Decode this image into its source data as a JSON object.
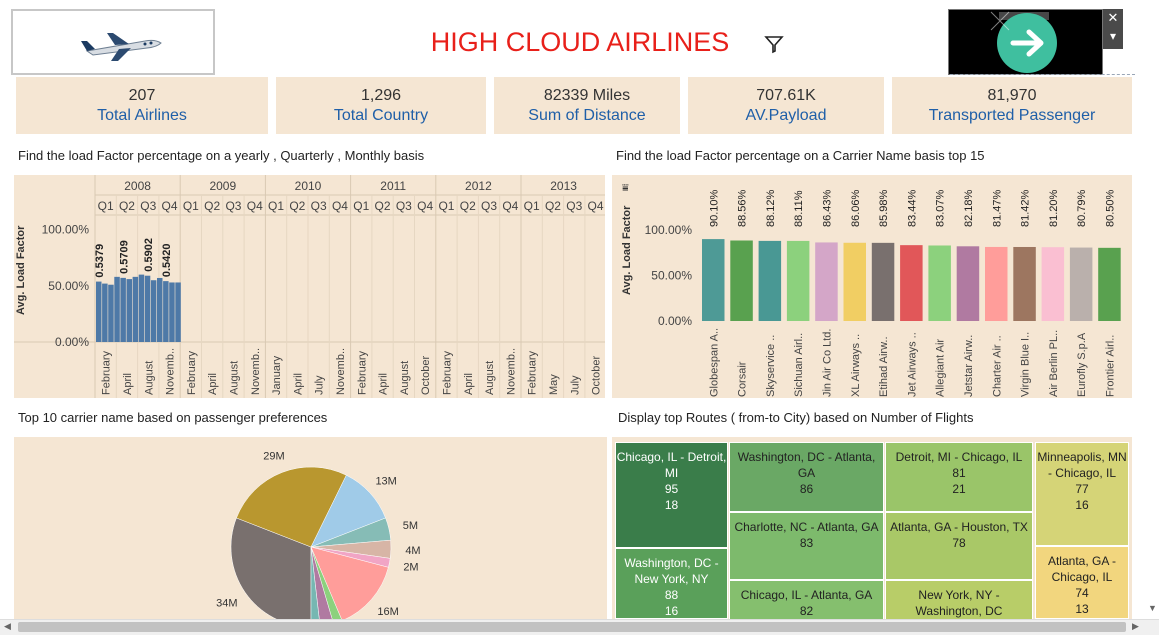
{
  "header": {
    "title": "HIGH CLOUD AIRLINES",
    "logo_icon": "airplane-logo-icon",
    "filter_icon": "filter-icon",
    "ad_icon": "arrow-right-icon",
    "close_symbol": "✕",
    "menu_symbol": "▾"
  },
  "kpis": [
    {
      "value": "207",
      "label": "Total Airlines"
    },
    {
      "value": "1,296",
      "label": "Total Country"
    },
    {
      "value": "82339 Miles",
      "label": "Sum of Distance"
    },
    {
      "value": "707.61K",
      "label": "AV.Payload"
    },
    {
      "value": "81,970",
      "label": "Transported Passenger"
    }
  ],
  "sections": {
    "load_yearly_title": "Find the load Factor percentage on a yearly , Quarterly , Monthly basis",
    "load_carrier_title": "Find the load Factor percentage on a Carrier Name basis top 15",
    "passenger_title": "Top 10 carrier name based on passenger preferences",
    "routes_title": "Display top Routes ( from-to City) based on Number of Flights"
  },
  "chart_data": [
    {
      "type": "bar",
      "title": "Find the load Factor percentage on a yearly , Quarterly , Monthly basis",
      "ylabel": "Avg. Load Factor",
      "ylim": [
        0,
        1
      ],
      "yticks": [
        "100.00%",
        "50.00%",
        "0.00%"
      ],
      "years": [
        "2008",
        "2009",
        "2010",
        "2011",
        "2012",
        "2013"
      ],
      "quarters": [
        "Q1",
        "Q2",
        "Q3",
        "Q4"
      ],
      "month_labels": [
        "February",
        "April",
        "August",
        "Novemb..",
        "February",
        "April",
        "August",
        "Novemb..",
        "January",
        "April",
        "July",
        "Novemb..",
        "February",
        "April",
        "August",
        "October",
        "February",
        "April",
        "August",
        "Novemb..",
        "February",
        "May",
        "July",
        "October"
      ],
      "values": [
        0.5379,
        0.52,
        0.51,
        0.58,
        0.5709,
        0.56,
        0.58,
        0.6,
        0.5902,
        0.55,
        0.57,
        0.542,
        0.53,
        0.53
      ],
      "data_labels": [
        "0.5379",
        "0.5709",
        "0.5902",
        "0.5420"
      ],
      "grid": true
    },
    {
      "type": "bar",
      "title": "Find the load Factor percentage on a Carrier Name basis top 15",
      "ylabel": "Avg. Load Factor",
      "ylim": [
        0,
        1
      ],
      "yticks": [
        "100.00%",
        "50.00%",
        "0.00%"
      ],
      "categories": [
        "Globespan A..",
        "Corsair",
        "Skyservice ..",
        "Sichuan Airl..",
        "Jin Air Co Ltd.",
        "XL Airways ..",
        "Etihad Airw..",
        "Jet Airways ..",
        "Allegiant Air",
        "Jetstar Airw..",
        "Charter Air ..",
        "Virgin Blue I..",
        "Air Berlin PL..",
        "Eurofly S.p.A",
        "Frontier Airl.."
      ],
      "values": [
        0.901,
        0.8856,
        0.8812,
        0.8811,
        0.8643,
        0.8606,
        0.8598,
        0.8344,
        0.8307,
        0.8218,
        0.8147,
        0.8142,
        0.812,
        0.8079,
        0.805
      ],
      "labels": [
        "90.10%",
        "88.56%",
        "88.12%",
        "88.11%",
        "86.43%",
        "86.06%",
        "85.98%",
        "83.44%",
        "83.07%",
        "82.18%",
        "81.47%",
        "81.42%",
        "81.20%",
        "80.79%",
        "80.50%"
      ],
      "colors": [
        "#4e9a96",
        "#59a14f",
        "#499894",
        "#8cd17d",
        "#d4a6c8",
        "#f1ce63",
        "#79706e",
        "#e15759",
        "#8cd17d",
        "#b07aa1",
        "#ff9d9a",
        "#9d7660",
        "#fabfd2",
        "#bab0ac",
        "#59a14f"
      ]
    },
    {
      "type": "pie",
      "title": "Top 10 carrier name based on passenger preferences",
      "values": [
        34,
        29,
        13,
        5,
        4,
        2,
        16,
        2,
        3,
        2
      ],
      "labels": [
        "34M",
        "29M",
        "13M",
        "5M",
        "4M",
        "2M",
        "16M",
        "",
        "",
        ""
      ],
      "colors": [
        "#79706e",
        "#b9972f",
        "#a0cbe8",
        "#86bcb6",
        "#d7b5a6",
        "#f1a5c5",
        "#ff9d9a",
        "#8cd17d",
        "#b07aa1",
        "#76b7b2"
      ]
    },
    {
      "type": "heatmap",
      "title": "Display top Routes ( from-to City) based on Number of Flights",
      "cells": [
        {
          "route": "Chicago, IL - Detroit, MI",
          "flights": "95",
          "extra": "18"
        },
        {
          "route": "Washington, DC - New York, NY",
          "flights": "88",
          "extra": "16"
        },
        {
          "route": "Washington, DC - Atlanta, GA",
          "flights": "86",
          "extra": ""
        },
        {
          "route": "Charlotte, NC - Atlanta, GA",
          "flights": "83",
          "extra": ""
        },
        {
          "route": "Chicago, IL - Atlanta, GA",
          "flights": "82",
          "extra": ""
        },
        {
          "route": "Detroit, MI - Chicago, IL",
          "flights": "81",
          "extra": "21"
        },
        {
          "route": "Atlanta, GA - Houston, TX",
          "flights": "78",
          "extra": ""
        },
        {
          "route": "New York, NY - Washington, DC",
          "flights": "",
          "extra": ""
        },
        {
          "route": "Minneapolis, MN - Chicago, IL",
          "flights": "77",
          "extra": "16"
        },
        {
          "route": "Atlanta, GA - Chicago, IL",
          "flights": "74",
          "extra": "13"
        }
      ]
    }
  ]
}
